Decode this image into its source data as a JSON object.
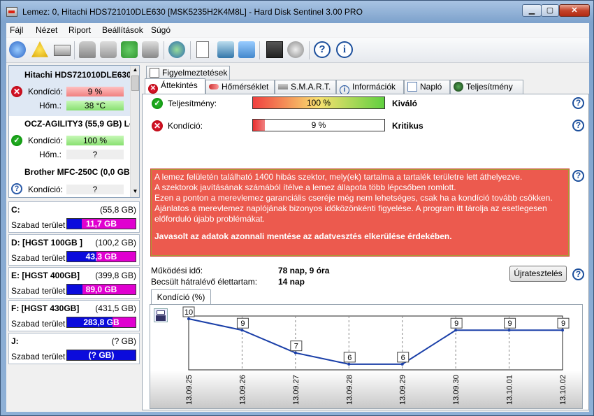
{
  "window": {
    "title": "Lemez: 0, Hitachi HDS721010DLE630 [MSK5235H2K4M8L]  -  Hard Disk Sentinel 3.00 PRO"
  },
  "menu": [
    "Fájl",
    "Nézet",
    "Riport",
    "Beállítások",
    "Súgó"
  ],
  "disks": [
    {
      "name": "Hitachi HDS721010DLE630",
      "status": "critical",
      "condition_label": "Kondíció:",
      "condition": "9 %",
      "temp_label": "Hőm.:",
      "temp": "38 °C"
    },
    {
      "name": "OCZ-AGILITY3 (55,9 GB) Le",
      "status": "ok",
      "condition_label": "Kondíció:",
      "condition": "100 %",
      "temp_label": "Hőm.:",
      "temp": "?"
    },
    {
      "name": "Brother MFC-250C (0,0 GB)",
      "status": "unknown",
      "condition_label": "Kondíció:",
      "condition": "?"
    }
  ],
  "volumes": [
    {
      "name": "C:",
      "size": "(55,8 GB)",
      "free_label": "Szabad terület",
      "free": "11,7 GB",
      "used_fraction": 0.79
    },
    {
      "name": "D: [HGST 100GB ]",
      "size": "(100,2 GB)",
      "free_label": "Szabad terület",
      "free": "43,3 GB",
      "used_fraction": 0.57
    },
    {
      "name": "E: [HGST 400GB]",
      "size": "(399,8 GB)",
      "free_label": "Szabad terület",
      "free": "89,0 GB",
      "used_fraction": 0.78
    },
    {
      "name": "F: [HGST 430GB]",
      "size": "(431,5 GB)",
      "free_label": "Szabad terület",
      "free": "283,8 GB",
      "used_fraction": 0.34
    },
    {
      "name": "J:",
      "size": "(? GB)",
      "free_label": "Szabad terület",
      "free": "(? GB)",
      "used_fraction": 0
    }
  ],
  "tabs": {
    "top": "Figyelmeztetések",
    "row": [
      "Áttekintés",
      "Hőmérséklet",
      "S.M.A.R.T.",
      "Információk",
      "Napló",
      "Teljesítmény"
    ]
  },
  "overview": {
    "performance_label": "Teljesítmény:",
    "performance_value": "100 %",
    "performance_percent": 100,
    "performance_status": "Kiváló",
    "condition_label": "Kondíció:",
    "condition_value": "9 %",
    "condition_percent": 9,
    "condition_status": "Kritikus",
    "alert_lines": [
      "A lemez felületén található 1400 hibás szektor, mely(ek) tartalma a tartalék területre lett áthelyezve.",
      "A szektorok javításának számából ítélve a lemez állapota több lépcsőben romlott.",
      "Ezen a ponton a merevlemez garanciális cseréje még nem lehetséges, csak ha a kondíció tovább csökken.",
      "Ajánlatos a merevlemez naplójának bizonyos időközönkénti figyelése. A program itt tárolja az esetlegesen előforduló újabb problémákat."
    ],
    "alert_bold": "Javasolt az adatok azonnali mentése az adatvesztés elkerülése érdekében.",
    "uptime_label": "Működési idő:",
    "uptime_value": "78 nap, 9 óra",
    "lifetime_label": "Becsült hátralévő élettartam:",
    "lifetime_value": "14 nap",
    "retest_button": "Újratesztelés",
    "chart_tab": "Kondíció  (%)"
  },
  "chart_data": {
    "type": "line",
    "x": [
      "13.09.25",
      "13.09.26",
      "13.09.27",
      "13.09.28",
      "13.09.29",
      "13.09.30",
      "13.10.01",
      "13.10.02"
    ],
    "values": [
      10,
      9,
      7,
      6,
      6,
      9,
      9,
      9
    ],
    "data_labels": [
      "10",
      "9",
      "7",
      "6",
      "6",
      "9",
      "9",
      "9"
    ],
    "title": "Kondíció  (%)",
    "ylim": [
      6,
      10
    ],
    "grid": "vertical dashed",
    "line_color": "#1a3fa8"
  },
  "colors": {
    "alert_bg": "#ec5a4e",
    "volume_free": "#0b0bdc",
    "volume_used": "#e000d0"
  }
}
